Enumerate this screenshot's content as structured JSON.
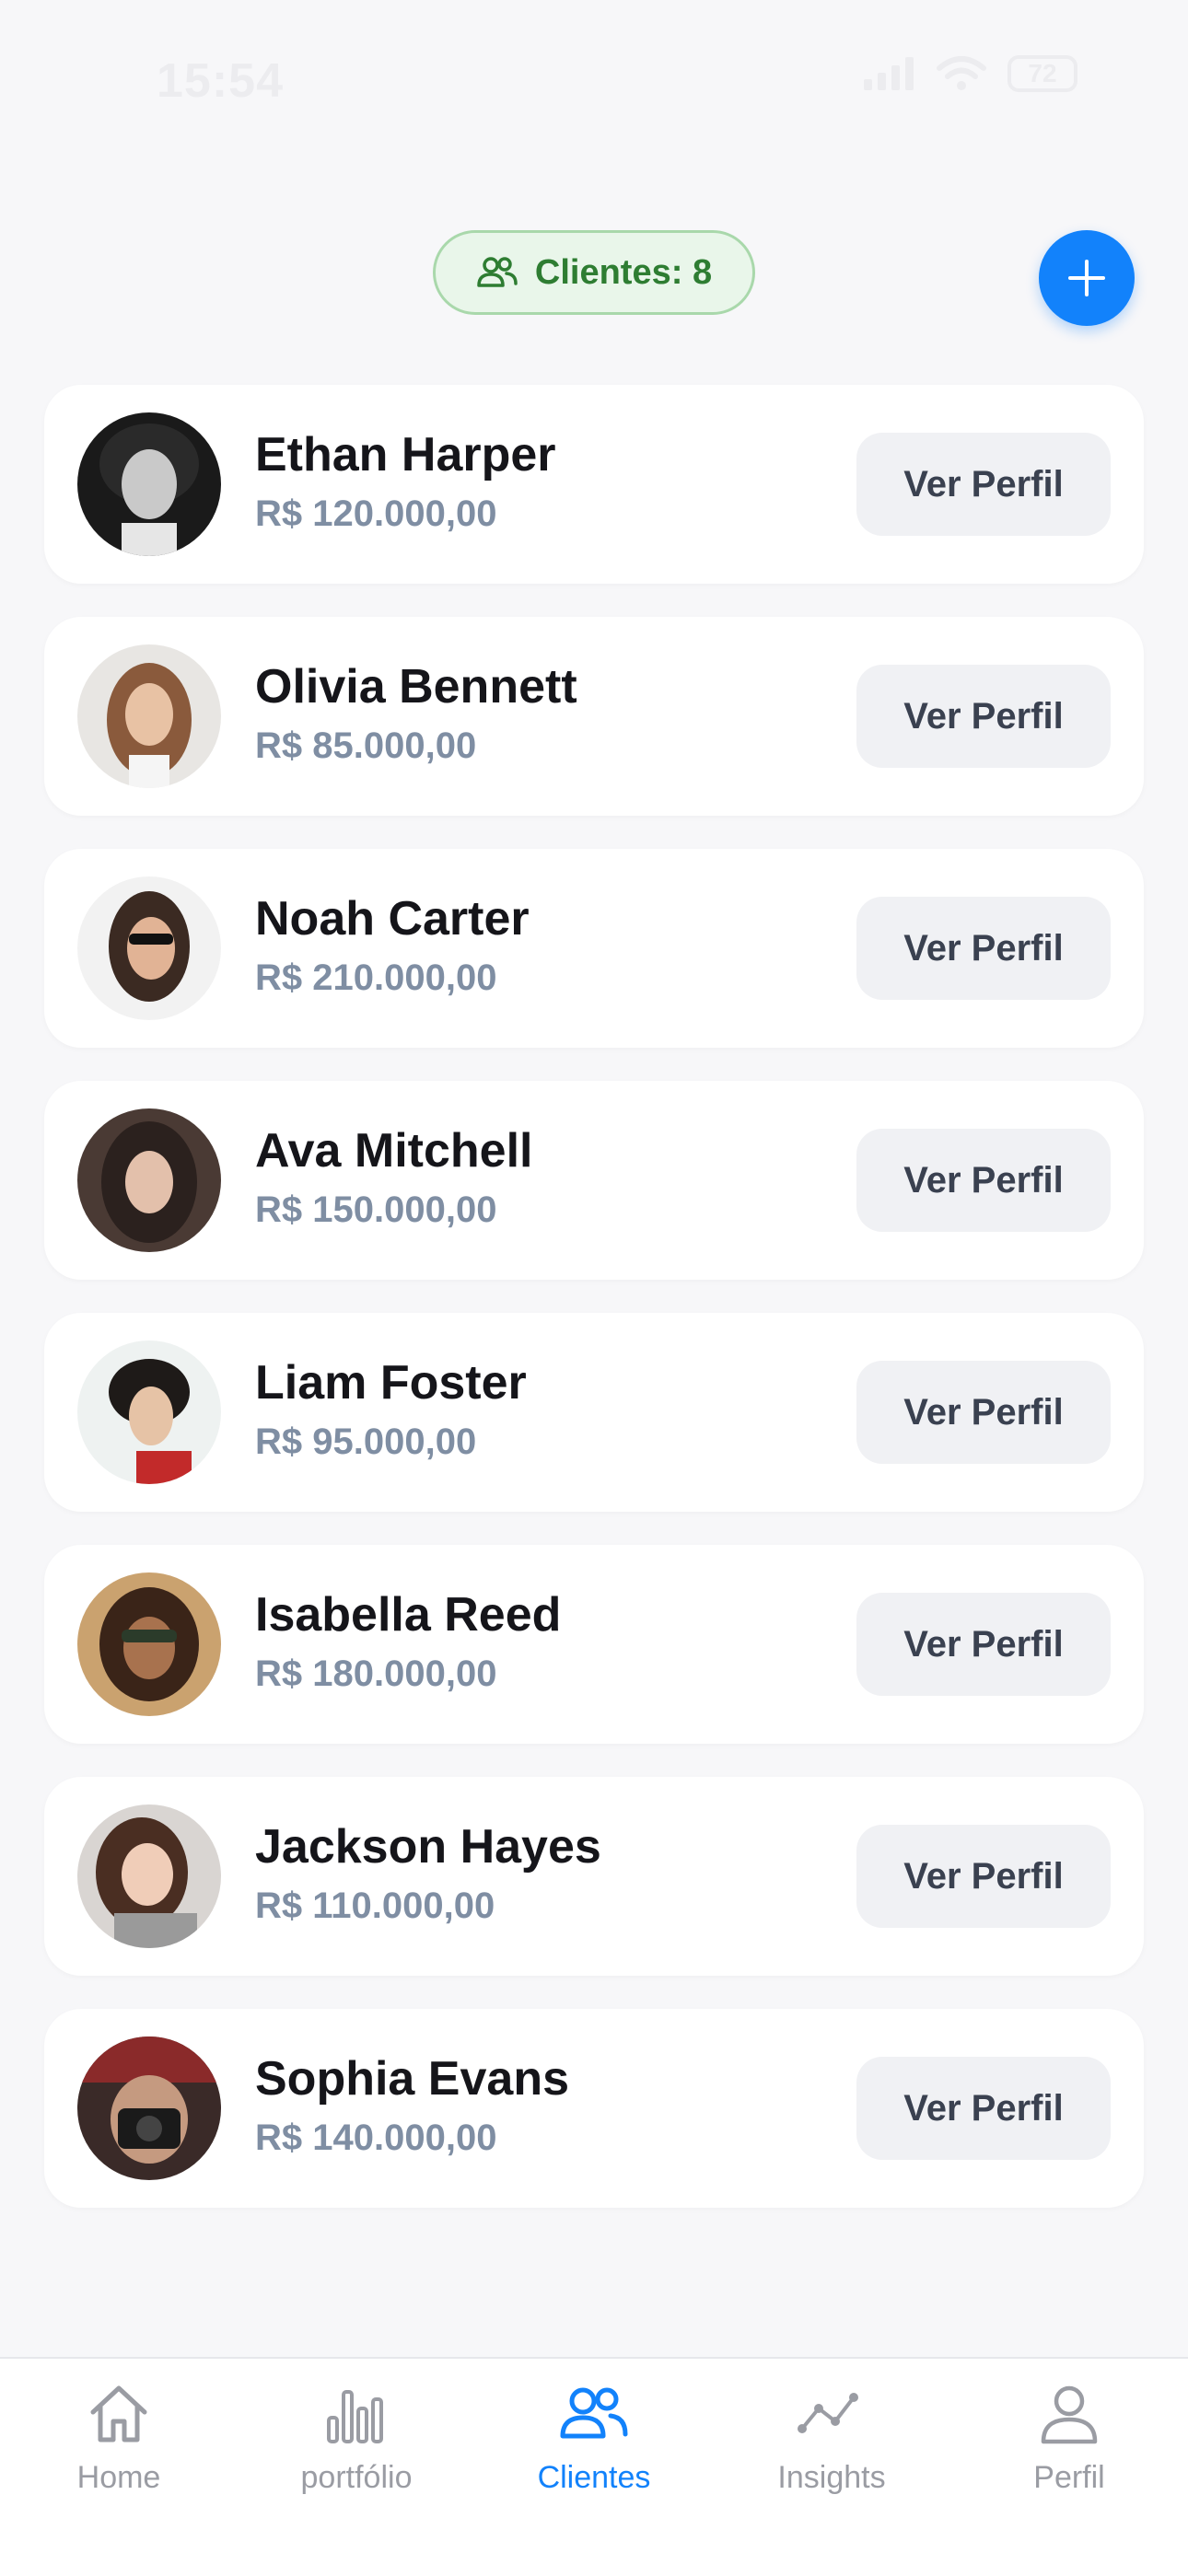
{
  "status_bar": {
    "time": "15:54",
    "battery": "72"
  },
  "header": {
    "clients_badge": "Clientes: 8",
    "add_icon": "plus-icon"
  },
  "clients": [
    {
      "name": "Ethan Harper",
      "value": "R$ 120.000,00",
      "button": "Ver Perfil"
    },
    {
      "name": "Olivia Bennett",
      "value": "R$ 85.000,00",
      "button": "Ver Perfil"
    },
    {
      "name": "Noah Carter",
      "value": "R$ 210.000,00",
      "button": "Ver Perfil"
    },
    {
      "name": "Ava Mitchell",
      "value": "R$ 150.000,00",
      "button": "Ver Perfil"
    },
    {
      "name": "Liam Foster",
      "value": "R$ 95.000,00",
      "button": "Ver Perfil"
    },
    {
      "name": "Isabella Reed",
      "value": "R$ 180.000,00",
      "button": "Ver Perfil"
    },
    {
      "name": "Jackson Hayes",
      "value": "R$ 110.000,00",
      "button": "Ver Perfil"
    },
    {
      "name": "Sophia Evans",
      "value": "R$ 140.000,00",
      "button": "Ver Perfil"
    }
  ],
  "tabs": [
    {
      "label": "Home",
      "icon": "home-icon"
    },
    {
      "label": "portfólio",
      "icon": "bar-chart-icon"
    },
    {
      "label": "Clientes",
      "icon": "users-icon"
    },
    {
      "label": "Insights",
      "icon": "trend-line-icon"
    },
    {
      "label": "Perfil",
      "icon": "person-icon"
    }
  ],
  "colors": {
    "accent": "#1282fb",
    "badge_green": "#2e7d32",
    "badge_bg": "#e9f6ea",
    "tab_inactive": "#9a9ca3"
  }
}
